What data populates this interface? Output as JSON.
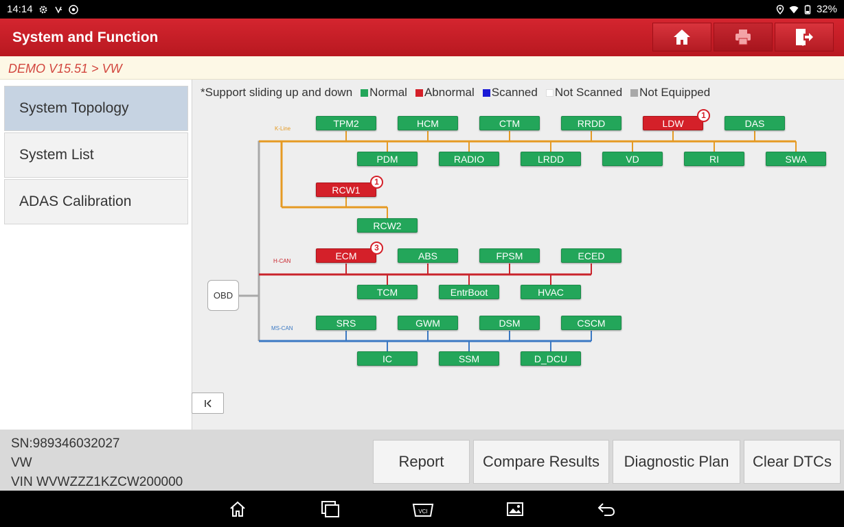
{
  "status_bar": {
    "time": "14:14",
    "battery": "32%"
  },
  "header": {
    "title": "System and Function"
  },
  "breadcrumb": {
    "text": "DEMO V15.51 > VW"
  },
  "sidebar": {
    "items": [
      {
        "label": "System Topology",
        "active": true
      },
      {
        "label": "System List",
        "active": false
      },
      {
        "label": "ADAS Calibration",
        "active": false
      }
    ]
  },
  "legend": {
    "hint": "*Support sliding up and down",
    "items": [
      {
        "label": "Normal",
        "color": "#23a65a"
      },
      {
        "label": "Abnormal",
        "color": "#d42029"
      },
      {
        "label": "Scanned",
        "color": "#1a1ad6"
      },
      {
        "label": "Not Scanned",
        "color": "#ffffff"
      },
      {
        "label": "Not Equipped",
        "color": "#a8a8a8"
      }
    ]
  },
  "topology": {
    "obd_label": "OBD",
    "buses": [
      {
        "name": "K-Line",
        "color": "#e59a23"
      },
      {
        "name": "H-CAN",
        "color": "#c9232b"
      },
      {
        "name": "MS-CAN",
        "color": "#3a78c3"
      }
    ],
    "kline_top": [
      {
        "name": "TPM2",
        "status": "normal",
        "badge": ""
      },
      {
        "name": "HCM",
        "status": "normal",
        "badge": ""
      },
      {
        "name": "CTM",
        "status": "normal",
        "badge": ""
      },
      {
        "name": "RRDD",
        "status": "normal",
        "badge": ""
      },
      {
        "name": "LDW",
        "status": "abnormal",
        "badge": "1"
      },
      {
        "name": "DAS",
        "status": "normal",
        "badge": ""
      }
    ],
    "kline_bottom": [
      {
        "name": "PDM",
        "status": "normal"
      },
      {
        "name": "RADIO",
        "status": "normal"
      },
      {
        "name": "LRDD",
        "status": "normal"
      },
      {
        "name": "VD",
        "status": "normal"
      },
      {
        "name": "RI",
        "status": "normal"
      },
      {
        "name": "SWA",
        "status": "normal"
      }
    ],
    "kline_branch": [
      {
        "name": "RCW1",
        "status": "abnormal",
        "badge": "1"
      },
      {
        "name": "RCW2",
        "status": "normal",
        "badge": ""
      }
    ],
    "hcan_top": [
      {
        "name": "ECM",
        "status": "abnormal",
        "badge": "3"
      },
      {
        "name": "ABS",
        "status": "normal",
        "badge": ""
      },
      {
        "name": "FPSM",
        "status": "normal",
        "badge": ""
      },
      {
        "name": "ECED",
        "status": "normal",
        "badge": ""
      }
    ],
    "hcan_bottom": [
      {
        "name": "TCM",
        "status": "normal"
      },
      {
        "name": "EntrBoot",
        "status": "normal"
      },
      {
        "name": "HVAC",
        "status": "normal"
      }
    ],
    "mscan_top": [
      {
        "name": "SRS",
        "status": "normal"
      },
      {
        "name": "GWM",
        "status": "normal"
      },
      {
        "name": "DSM",
        "status": "normal"
      },
      {
        "name": "CSCM",
        "status": "normal"
      }
    ],
    "mscan_bottom": [
      {
        "name": "IC",
        "status": "normal"
      },
      {
        "name": "SSM",
        "status": "normal"
      },
      {
        "name": "D_DCU",
        "status": "normal"
      }
    ]
  },
  "vehicle_info": {
    "sn": "SN:989346032027",
    "make": "VW",
    "vin": "VIN WVWZZZ1KZCW200000"
  },
  "actions": {
    "report": "Report",
    "compare": "Compare Results",
    "plan": "Diagnostic Plan",
    "clear": "Clear DTCs"
  }
}
